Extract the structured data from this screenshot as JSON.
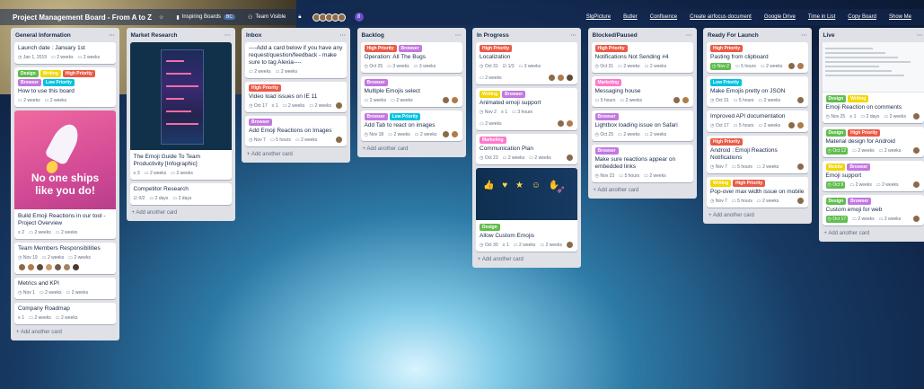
{
  "board": {
    "title": "Project Management Board - From A to Z",
    "star_icon": "star-icon",
    "team": "Inspiring Boards",
    "team_badge": "BC",
    "visibility": "Team Visible",
    "member_count": "8",
    "topbar_right": [
      "SlgPicture",
      "Butler",
      "Confluence",
      "Create airfocus document",
      "Google Drive",
      "Time in List",
      "Copy Board",
      "Show Me"
    ]
  },
  "colors": {
    "green": "#61bd4f",
    "yellow": "#f2d600",
    "orange": "#ff9f1a",
    "red": "#eb5a46",
    "purple": "#c377e0",
    "blue": "#0079bf",
    "sky": "#00c2e0",
    "pink": "#ff78cb"
  },
  "add_card_label": "+ Add another card",
  "lists": [
    {
      "title": "General Information",
      "cards": [
        {
          "title": "Launch date : January 1st",
          "meta": [
            "Jan 1, 2019",
            "2 weeks",
            "2 weeks"
          ]
        },
        {
          "labels": [
            [
              "Design",
              "#61bd4f"
            ],
            [
              "Writing",
              "#f2d600"
            ],
            [
              "High Priority",
              "#eb5a46"
            ],
            [
              "Browser",
              "#c377e0"
            ],
            [
              "Low Priority",
              "#00c2e0"
            ]
          ],
          "title": "How to use this board",
          "meta": [
            "2 weeks",
            "2 weeks"
          ]
        },
        {
          "cover": "rocket",
          "cover_text": [
            "No one ships",
            "like you do!"
          ],
          "title": "Build Emoji Reactions in our tool - Project Overview",
          "meta": [
            "2",
            "2 weeks",
            "2 weeks"
          ]
        },
        {
          "title": "Team Members Responsibilities",
          "meta": [
            "Nov 19",
            "2 weeks",
            "2 weeks"
          ],
          "avatars": 7
        },
        {
          "title": "Metrics and KPI",
          "meta": [
            "Nov 1",
            "2 weeks",
            "2 weeks"
          ]
        },
        {
          "title": "Company Roadmap",
          "meta": [
            "1",
            "2 weeks",
            "2 weeks"
          ]
        }
      ]
    },
    {
      "title": "Market Research",
      "cards": [
        {
          "cover": "info",
          "title": "The Emoji Guide To Team Productivity [Infographic]",
          "meta": [
            "3",
            "2 weeks",
            "2 weeks"
          ]
        },
        {
          "title": "Competitor Research",
          "meta": [
            "0/2",
            "2 days",
            "2 days"
          ]
        }
      ]
    },
    {
      "title": "Inbox",
      "cards": [
        {
          "title": "----Add a card below if you have any request/question/feedback - make sure to tag Alexia----",
          "meta": [
            "2 weeks",
            "2 weeks"
          ]
        },
        {
          "labels": [
            [
              "High Priority",
              "#eb5a46"
            ]
          ],
          "title": "Video load issues on IE 11",
          "meta": [
            "Oct 17",
            "1",
            "2 weeks",
            "2 weeks"
          ],
          "avatars": 1
        },
        {
          "labels": [
            [
              "Browser",
              "#c377e0"
            ]
          ],
          "title": "Add Emoji Reactions on Images",
          "meta": [
            "Nov 7",
            "5 hours",
            "2 weeks"
          ],
          "avatars": 1
        }
      ]
    },
    {
      "title": "Backlog",
      "cards": [
        {
          "labels": [
            [
              "High Priority",
              "#eb5a46"
            ],
            [
              "Browser",
              "#c377e0"
            ]
          ],
          "title": "Operation: All The Bugs",
          "meta": [
            "Oct 25",
            "3 weeks",
            "3 weeks"
          ]
        },
        {
          "labels": [
            [
              "Browser",
              "#c377e0"
            ]
          ],
          "title": "Multiple Emojis select",
          "meta": [
            "2 weeks",
            "2 weeks"
          ],
          "avatars": 2
        },
        {
          "labels": [
            [
              "Browser",
              "#c377e0"
            ],
            [
              "Low Priority",
              "#00c2e0"
            ]
          ],
          "title": "Add Tab to react on images",
          "meta": [
            "Nov 18",
            "2 weeks",
            "2 weeks"
          ],
          "avatars": 2
        }
      ]
    },
    {
      "title": "In Progress",
      "cards": [
        {
          "labels": [
            [
              "High Priority",
              "#eb5a46"
            ]
          ],
          "title": "Localization",
          "meta": [
            "Oct 31",
            "1/3",
            "3 weeks",
            "2 weeks"
          ],
          "avatars": 3
        },
        {
          "labels": [
            [
              "Writing",
              "#f2d600"
            ],
            [
              "Browser",
              "#c377e0"
            ]
          ],
          "title": "Animated emoji support",
          "meta": [
            "Nov 2",
            "1",
            "3 hours",
            "2 weeks"
          ],
          "avatars": 2
        },
        {
          "labels": [
            [
              "Marketing",
              "#ff78cb"
            ]
          ],
          "title": "Communication Plan",
          "meta": [
            "Oct 23",
            "2 weeks",
            "2 weeks"
          ],
          "avatars": 1
        },
        {
          "cover": "emoji",
          "labels": [
            [
              "Design",
              "#61bd4f"
            ]
          ],
          "title": "Allow Custom Emojis",
          "meta": [
            "Oct 30",
            "1",
            "2 weeks",
            "2 weeks"
          ],
          "avatars": 1
        }
      ]
    },
    {
      "title": "Blocked/Paused",
      "cards": [
        {
          "labels": [
            [
              "High Priority",
              "#eb5a46"
            ]
          ],
          "title": "Notifications Not Sending #4",
          "meta": [
            "Oct 31",
            "2 weeks",
            "2 weeks"
          ]
        },
        {
          "labels": [
            [
              "Marketing",
              "#ff78cb"
            ]
          ],
          "title": "Messaging house",
          "meta": [
            "5 hours",
            "2 weeks"
          ],
          "avatars": 2
        },
        {
          "labels": [
            [
              "Browser",
              "#c377e0"
            ]
          ],
          "title": "Lightbox loading issue on Safari",
          "meta": [
            "Oct 25",
            "2 weeks",
            "2 weeks"
          ]
        },
        {
          "labels": [
            [
              "Browser",
              "#c377e0"
            ]
          ],
          "title": "Make sure reactions appear on embedded links",
          "meta": [
            "Nov 23",
            "5 hours",
            "2 weeks"
          ]
        }
      ]
    },
    {
      "title": "Ready For Launch",
      "cards": [
        {
          "labels": [
            [
              "High Priority",
              "#eb5a46"
            ]
          ],
          "title": "Pasting from clipboard",
          "meta": [
            "Nov 2",
            "5 hours",
            "2 weeks"
          ],
          "due": true,
          "avatars": 2
        },
        {
          "labels": [
            [
              "Low Priority",
              "#00c2e0"
            ]
          ],
          "title": "Make Emojis pretty on JSON",
          "meta": [
            "Oct 31",
            "5 hours",
            "2 weeks"
          ],
          "avatars": 1
        },
        {
          "title": "Improved API documentation",
          "meta": [
            "Oct 17",
            "5 hours",
            "2 weeks"
          ],
          "avatars": 2
        },
        {
          "labels": [
            [
              "High Priority",
              "#eb5a46"
            ]
          ],
          "title": "Android : Emoji Reactions Notifications",
          "meta": [
            "Nov 7",
            "5 hours",
            "2 weeks"
          ],
          "avatars": 1
        },
        {
          "labels": [
            [
              "Writing",
              "#f2d600"
            ],
            [
              "High Priority",
              "#eb5a46"
            ]
          ],
          "title": "Pop-over max width issue on mobile",
          "meta": [
            "Nov 7",
            "5 hours",
            "2 weeks"
          ],
          "avatars": 1
        }
      ]
    },
    {
      "title": "Live",
      "cards": [
        {
          "cover": "activity",
          "labels": [
            [
              "Design",
              "#61bd4f"
            ],
            [
              "Writing",
              "#f2d600"
            ]
          ],
          "title": "Emoji Reaction on comments",
          "meta": [
            "Nov 25",
            "1",
            "2 days",
            "2 weeks"
          ],
          "avatars": 1
        },
        {
          "labels": [
            [
              "Design",
              "#61bd4f"
            ],
            [
              "High Priority",
              "#eb5a46"
            ]
          ],
          "title": "Material design for Android",
          "meta": [
            "Oct 12",
            "2 weeks",
            "2 weeks"
          ],
          "due": true,
          "avatars": 1
        },
        {
          "labels": [
            [
              "Mobile",
              "#f2d600"
            ],
            [
              "Browser",
              "#c377e0"
            ]
          ],
          "title": "Emoji support",
          "meta": [
            "Oct 9",
            "2 weeks",
            "2 weeks"
          ],
          "due": true,
          "avatars": 1
        },
        {
          "labels": [
            [
              "Design",
              "#61bd4f"
            ],
            [
              "Browser",
              "#c377e0"
            ]
          ],
          "title": "Custom emoji for web",
          "meta": [
            "Oct 17",
            "2 weeks",
            "2 weeks"
          ],
          "due": true,
          "avatars": 1
        }
      ]
    }
  ]
}
